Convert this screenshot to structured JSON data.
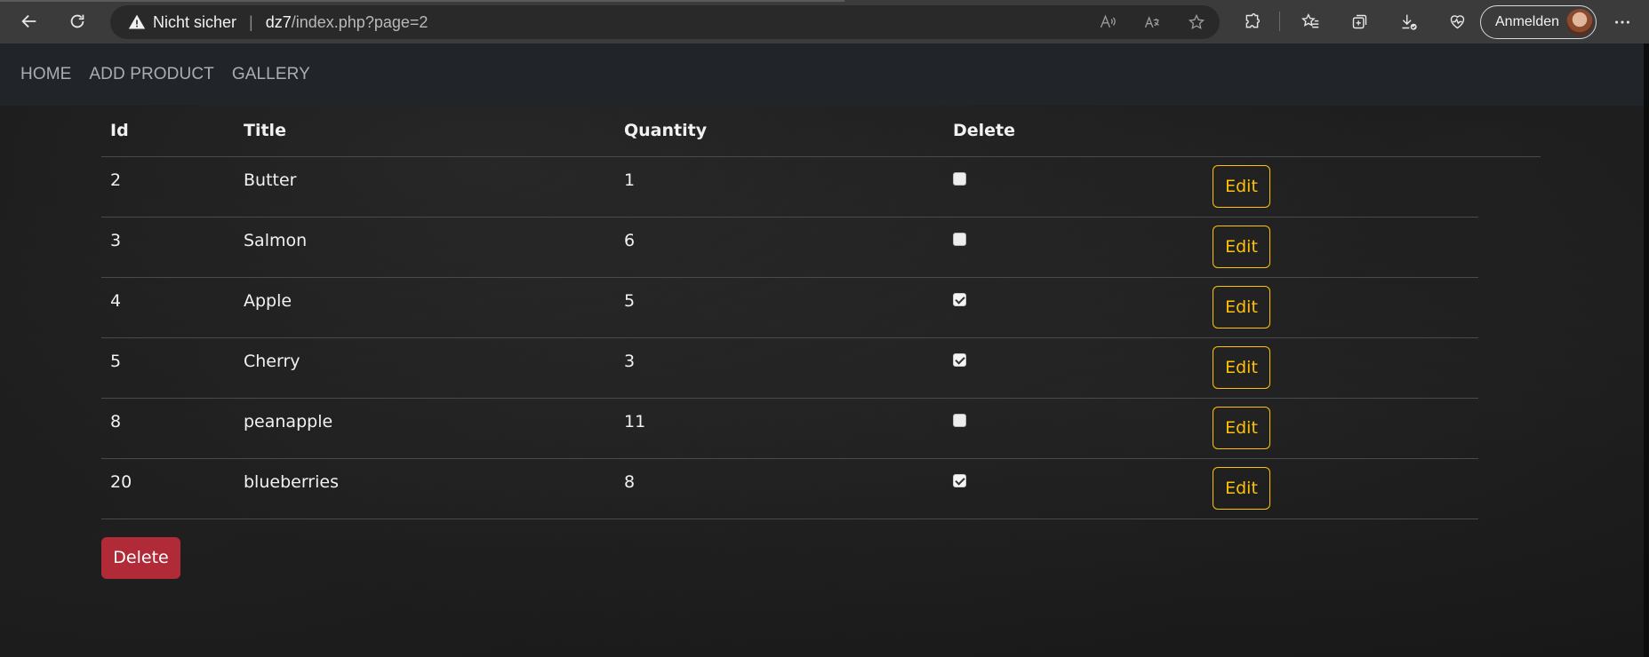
{
  "browser": {
    "security_label": "Nicht sicher",
    "url_host": "dz7",
    "url_path": "/index.php?page=2",
    "signin_label": "Anmelden",
    "icons": [
      "back-icon",
      "reload-icon",
      "warning-icon",
      "read-aloud-icon",
      "translate-icon",
      "favorite-star-icon",
      "extensions-icon",
      "favorites-icon",
      "collections-icon",
      "downloads-icon",
      "browser-essentials-icon",
      "more-icon"
    ]
  },
  "nav": {
    "items": [
      {
        "label": "HOME"
      },
      {
        "label": "ADD PRODUCT"
      },
      {
        "label": "GALLERY"
      }
    ]
  },
  "table": {
    "headers": [
      "Id",
      "Title",
      "Quantity",
      "Delete"
    ],
    "rows": [
      {
        "id": "2",
        "title": "Butter",
        "quantity": "1",
        "checked": false,
        "edit_label": "Edit"
      },
      {
        "id": "3",
        "title": "Salmon",
        "quantity": "6",
        "checked": false,
        "edit_label": "Edit"
      },
      {
        "id": "4",
        "title": "Apple",
        "quantity": "5",
        "checked": true,
        "edit_label": "Edit"
      },
      {
        "id": "5",
        "title": "Cherry",
        "quantity": "3",
        "checked": true,
        "edit_label": "Edit"
      },
      {
        "id": "8",
        "title": "peanapple",
        "quantity": "11",
        "checked": false,
        "edit_label": "Edit"
      },
      {
        "id": "20",
        "title": "blueberries",
        "quantity": "8",
        "checked": true,
        "edit_label": "Edit"
      }
    ]
  },
  "actions": {
    "delete_label": "Delete"
  },
  "colors": {
    "edit_outline": "#ffc107",
    "delete_button": "#b02a37",
    "navbar": "#212529"
  }
}
